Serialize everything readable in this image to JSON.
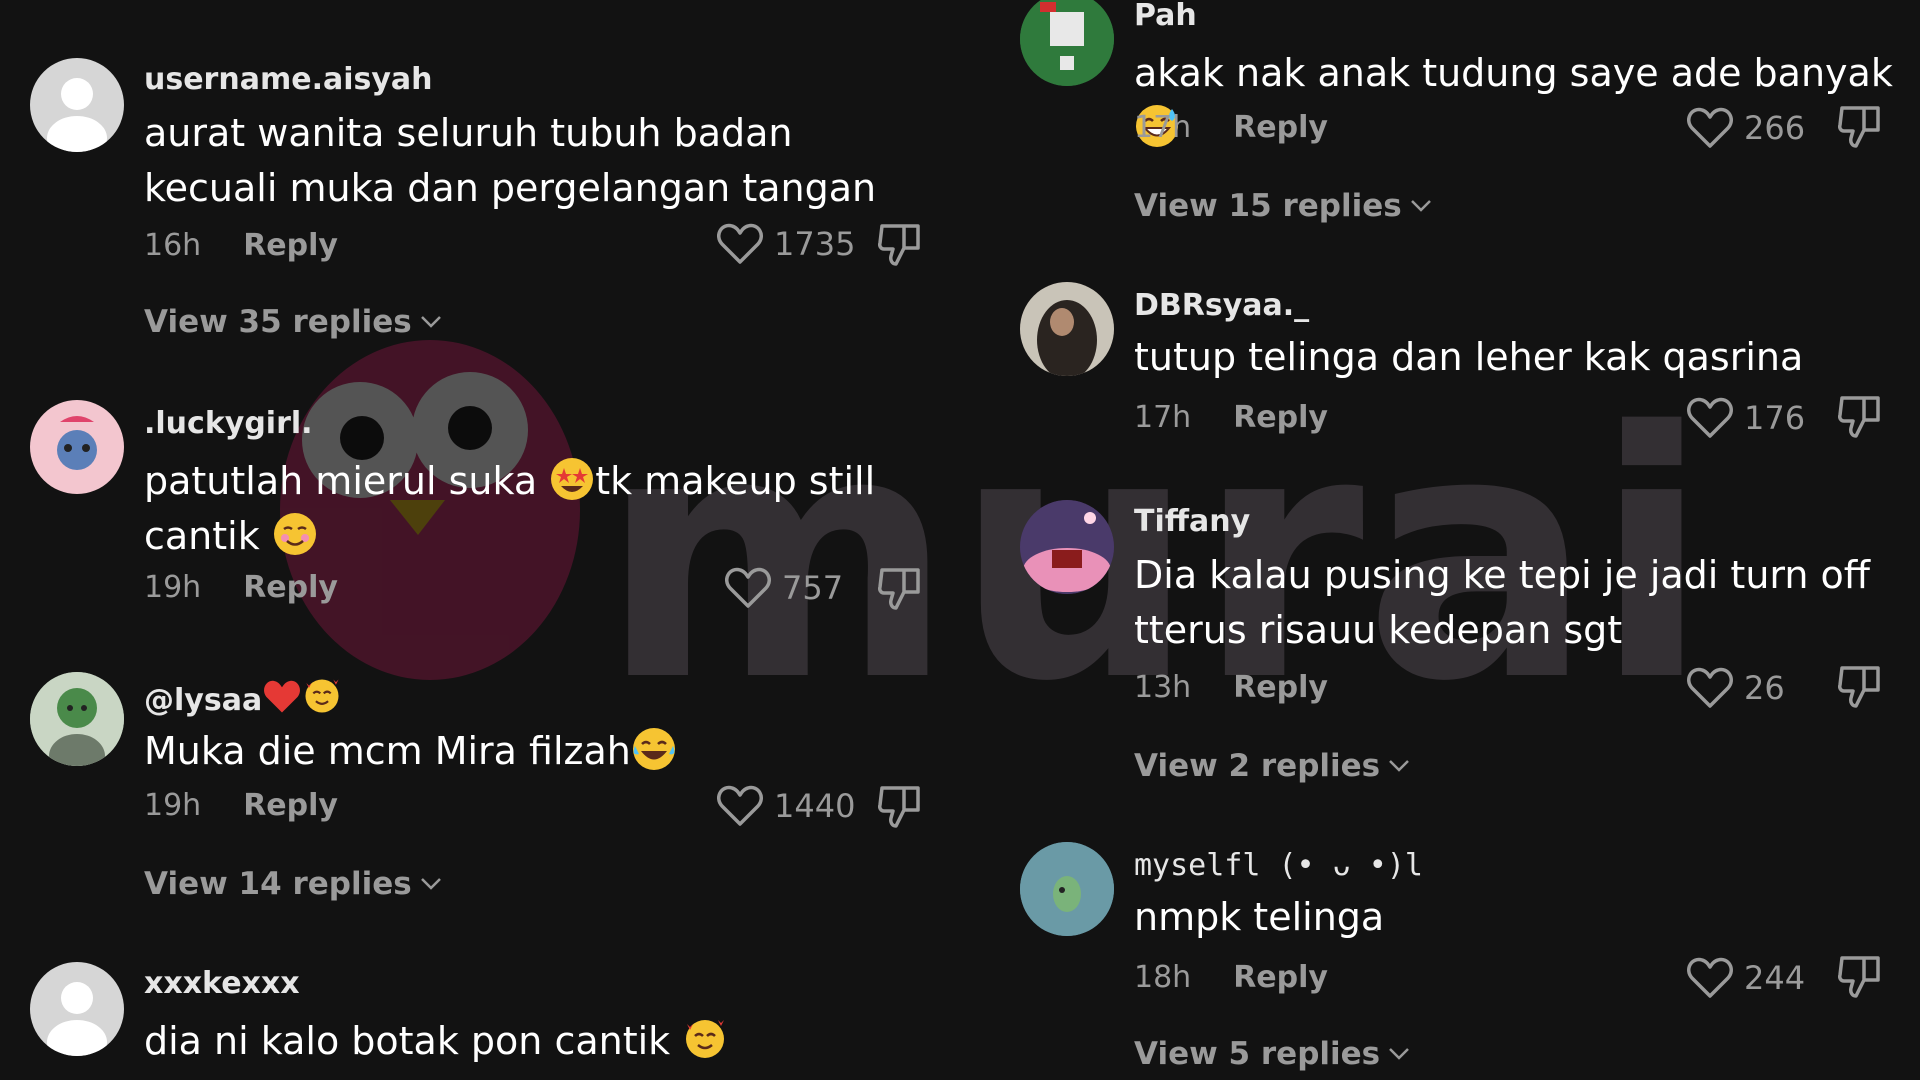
{
  "watermark": {
    "text": "murai"
  },
  "comments_left": [
    {
      "username": "username.aisyah",
      "text": "aurat wanita seluruh tubuh badan kecuali muka dan pergelangan tangan",
      "time": "16h",
      "reply": "Reply",
      "likes": "1735",
      "view_replies": "View 35 replies"
    },
    {
      "username": ".luckygirl.",
      "text_a": "patutlah mierul suka ",
      "text_b": "tk makeup still cantik ",
      "time": "19h",
      "reply": "Reply",
      "likes": "757"
    },
    {
      "username": "@lysaa",
      "text": "Muka die mcm Mira filzah",
      "time": "19h",
      "reply": "Reply",
      "likes": "1440",
      "view_replies": "View 14 replies"
    },
    {
      "username": "xxxkexxx",
      "text": "dia ni kalo botak pon cantik "
    }
  ],
  "comments_right": [
    {
      "username": "Pah",
      "text": "akak nak anak tudung saye ade banyak",
      "time": "17h",
      "reply": "Reply",
      "likes": "266",
      "view_replies": "View 15 replies"
    },
    {
      "username": "DBRsyaa._",
      "text": "tutup telinga dan leher kak qasrina",
      "time": "17h",
      "reply": "Reply",
      "likes": "176"
    },
    {
      "username": "Tiffany",
      "text": "Dia kalau pusing ke tepi je jadi turn off tterus risauu kedepan sgt",
      "time": "13h",
      "reply": "Reply",
      "likes": "26",
      "view_replies": "View 2 replies"
    },
    {
      "username": "myselfl (• ᴗ •)l",
      "text": "nmpk telinga",
      "time": "18h",
      "reply": "Reply",
      "likes": "244",
      "view_replies": "View 5 replies"
    }
  ],
  "colors": {
    "background": "#121212",
    "text": "#ffffff",
    "muted": "#9a9a9a",
    "watermark": "#4a3a48"
  }
}
